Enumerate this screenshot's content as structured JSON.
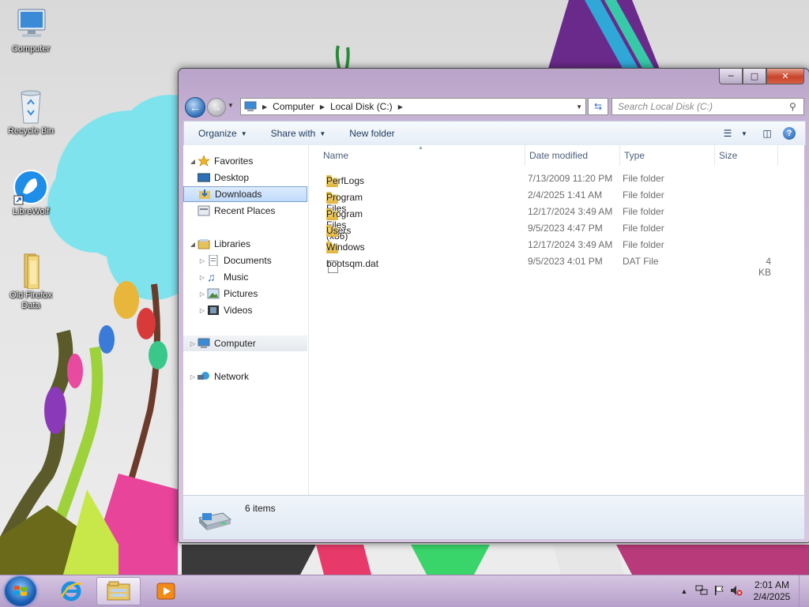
{
  "desktop": {
    "icons": [
      {
        "label": "Computer",
        "icon": "computer-icon"
      },
      {
        "label": "Recycle Bin",
        "icon": "recycle-bin-icon"
      },
      {
        "label": "LibreWolf",
        "icon": "librewolf-icon"
      },
      {
        "label": "Old Firefox Data",
        "icon": "folder-icon"
      }
    ]
  },
  "window": {
    "address": {
      "segments": [
        "Computer",
        "Local Disk (C:)"
      ]
    },
    "search": {
      "placeholder": "Search Local Disk (C:)"
    },
    "toolbar": {
      "organize": "Organize",
      "share_with": "Share with",
      "new_folder": "New folder"
    },
    "nav_pane": {
      "favorites": "Favorites",
      "desktop": "Desktop",
      "downloads": "Downloads",
      "recent_places": "Recent Places",
      "libraries": "Libraries",
      "documents": "Documents",
      "music": "Music",
      "pictures": "Pictures",
      "videos": "Videos",
      "computer": "Computer",
      "network": "Network"
    },
    "columns": {
      "name": "Name",
      "date_modified": "Date modified",
      "type": "Type",
      "size": "Size"
    },
    "files": [
      {
        "name": "PerfLogs",
        "date": "7/13/2009 11:20 PM",
        "type": "File folder",
        "size": "",
        "kind": "folder"
      },
      {
        "name": "Program Files",
        "date": "2/4/2025 1:41 AM",
        "type": "File folder",
        "size": "",
        "kind": "folder"
      },
      {
        "name": "Program Files (x86)",
        "date": "12/17/2024 3:49 AM",
        "type": "File folder",
        "size": "",
        "kind": "folder"
      },
      {
        "name": "Users",
        "date": "9/5/2023 4:47 PM",
        "type": "File folder",
        "size": "",
        "kind": "folder"
      },
      {
        "name": "Windows",
        "date": "12/17/2024 3:49 AM",
        "type": "File folder",
        "size": "",
        "kind": "folder"
      },
      {
        "name": "bootsqm.dat",
        "date": "9/5/2023 4:01 PM",
        "type": "DAT File",
        "size": "4 KB",
        "kind": "file"
      }
    ],
    "details": {
      "item_count": "6 items"
    }
  },
  "taskbar": {
    "clock": {
      "time": "2:01 AM",
      "date": "2/4/2025"
    },
    "pinned": [
      "internet-explorer-icon",
      "windows-explorer-icon",
      "media-player-icon"
    ]
  },
  "colors": {
    "accent": "#1d5bb0",
    "selection": "#c1dbfc",
    "taskbar": "#c4afd6"
  }
}
